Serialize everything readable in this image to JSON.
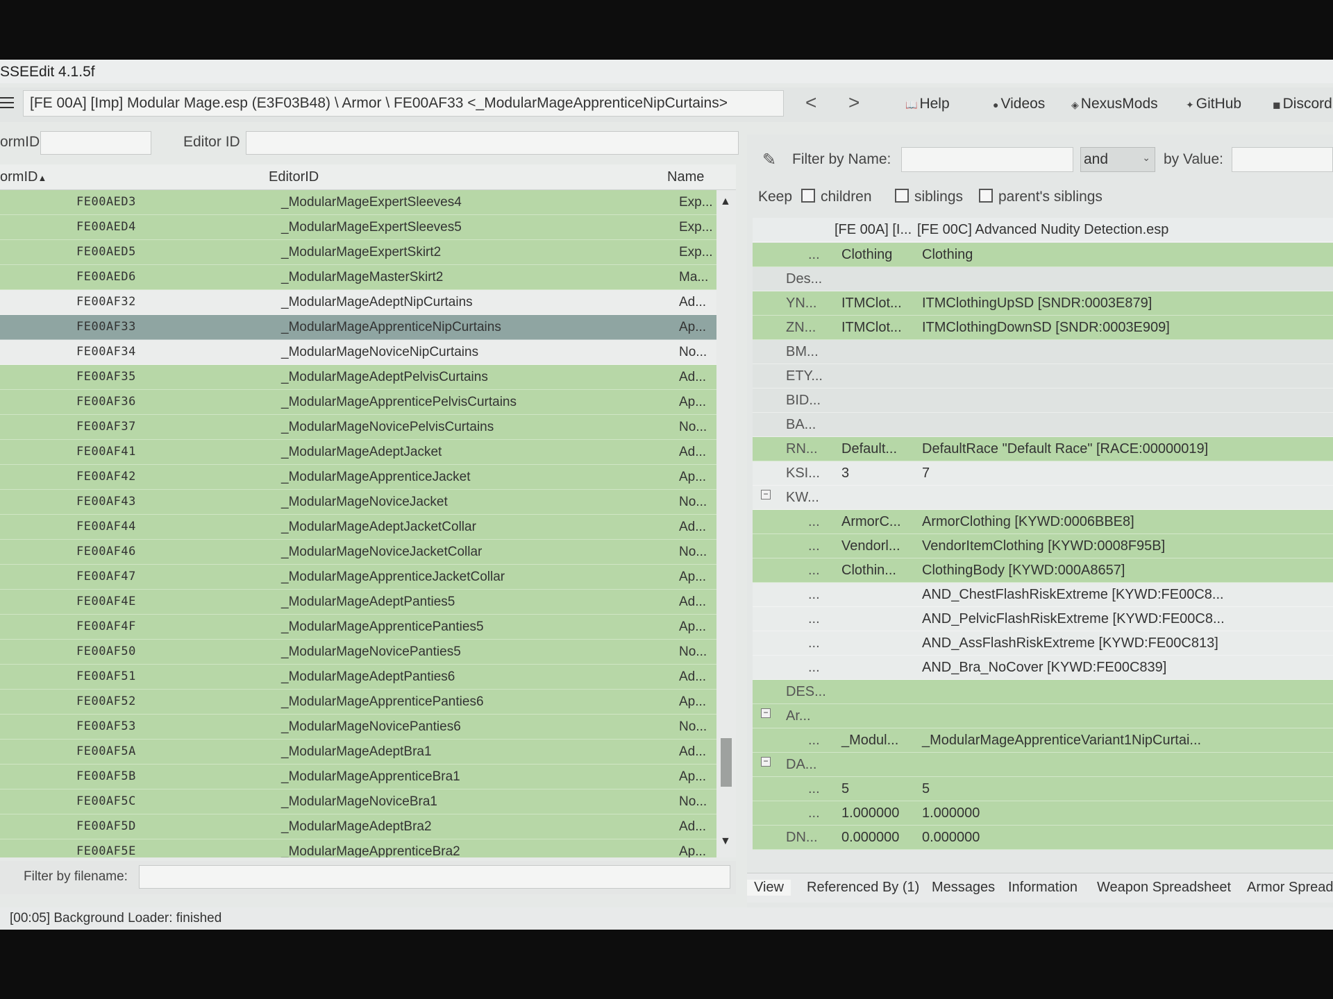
{
  "window": {
    "title": "SSEEdit 4.1.5f"
  },
  "nav": {
    "path": "[FE 00A] [Imp] Modular Mage.esp (E3F03B48) \\ Armor \\ FE00AF33 <_ModularMageApprenticeNipCurtains>",
    "back_glyph": "<",
    "forward_glyph": ">",
    "links": [
      "Help",
      "Videos",
      "NexusMods",
      "GitHub",
      "Discord"
    ]
  },
  "search": {
    "formid_label": "ormID",
    "formid_value": "",
    "editorid_label": "Editor ID",
    "editorid_value": ""
  },
  "record_list": {
    "columns": [
      "ormID",
      "EditorID",
      "Name"
    ],
    "sort_indicator": "▲",
    "rows": [
      {
        "formid": "FE00AED3",
        "editorid": "_ModularMageExpertSleeves4",
        "name": "Exp...",
        "color": "green"
      },
      {
        "formid": "FE00AED4",
        "editorid": "_ModularMageExpertSleeves5",
        "name": "Exp...",
        "color": "green"
      },
      {
        "formid": "FE00AED5",
        "editorid": "_ModularMageExpertSkirt2",
        "name": "Exp...",
        "color": "green"
      },
      {
        "formid": "FE00AED6",
        "editorid": "_ModularMageMasterSkirt2",
        "name": "Ma...",
        "color": "green"
      },
      {
        "formid": "FE00AF32",
        "editorid": "_ModularMageAdeptNipCurtains",
        "name": "Ad...",
        "color": "white"
      },
      {
        "formid": "FE00AF33",
        "editorid": "_ModularMageApprenticeNipCurtains",
        "name": "Ap...",
        "color": "selected"
      },
      {
        "formid": "FE00AF34",
        "editorid": "_ModularMageNoviceNipCurtains",
        "name": "No...",
        "color": "white"
      },
      {
        "formid": "FE00AF35",
        "editorid": "_ModularMageAdeptPelvisCurtains",
        "name": "Ad...",
        "color": "green"
      },
      {
        "formid": "FE00AF36",
        "editorid": "_ModularMageApprenticePelvisCurtains",
        "name": "Ap...",
        "color": "green"
      },
      {
        "formid": "FE00AF37",
        "editorid": "_ModularMageNovicePelvisCurtains",
        "name": "No...",
        "color": "green"
      },
      {
        "formid": "FE00AF41",
        "editorid": "_ModularMageAdeptJacket",
        "name": "Ad...",
        "color": "green"
      },
      {
        "formid": "FE00AF42",
        "editorid": "_ModularMageApprenticeJacket",
        "name": "Ap...",
        "color": "green"
      },
      {
        "formid": "FE00AF43",
        "editorid": "_ModularMageNoviceJacket",
        "name": "No...",
        "color": "green"
      },
      {
        "formid": "FE00AF44",
        "editorid": "_ModularMageAdeptJacketCollar",
        "name": "Ad...",
        "color": "green"
      },
      {
        "formid": "FE00AF46",
        "editorid": "_ModularMageNoviceJacketCollar",
        "name": "No...",
        "color": "green"
      },
      {
        "formid": "FE00AF47",
        "editorid": "_ModularMageApprenticeJacketCollar",
        "name": "Ap...",
        "color": "green"
      },
      {
        "formid": "FE00AF4E",
        "editorid": "_ModularMageAdeptPanties5",
        "name": "Ad...",
        "color": "green"
      },
      {
        "formid": "FE00AF4F",
        "editorid": "_ModularMageApprenticePanties5",
        "name": "Ap...",
        "color": "green"
      },
      {
        "formid": "FE00AF50",
        "editorid": "_ModularMageNovicePanties5",
        "name": "No...",
        "color": "green"
      },
      {
        "formid": "FE00AF51",
        "editorid": "_ModularMageAdeptPanties6",
        "name": "Ad...",
        "color": "green"
      },
      {
        "formid": "FE00AF52",
        "editorid": "_ModularMageApprenticePanties6",
        "name": "Ap...",
        "color": "green"
      },
      {
        "formid": "FE00AF53",
        "editorid": "_ModularMageNovicePanties6",
        "name": "No...",
        "color": "green"
      },
      {
        "formid": "FE00AF5A",
        "editorid": "_ModularMageAdeptBra1",
        "name": "Ad...",
        "color": "green"
      },
      {
        "formid": "FE00AF5B",
        "editorid": "_ModularMageApprenticeBra1",
        "name": "Ap...",
        "color": "green"
      },
      {
        "formid": "FE00AF5C",
        "editorid": "_ModularMageNoviceBra1",
        "name": "No...",
        "color": "green"
      },
      {
        "formid": "FE00AF5D",
        "editorid": "_ModularMageAdeptBra2",
        "name": "Ad...",
        "color": "green"
      },
      {
        "formid": "FE00AF5E",
        "editorid": "_ModularMageApprenticeBra2",
        "name": "Ap...",
        "color": "green"
      }
    ]
  },
  "filter_file": {
    "label": "Filter by filename:",
    "value": ""
  },
  "filter_panel": {
    "by_name_label": "Filter by Name:",
    "by_name_value": "",
    "operator": "and",
    "by_value_label": "by Value:",
    "by_value_value": "",
    "keep_label": "Keep",
    "keep_options": [
      "children",
      "siblings",
      "parent's siblings"
    ]
  },
  "record_view": {
    "header": {
      "key": "",
      "col_a": "[FE 00A] [I...",
      "col_b": "[FE 00C] Advanced Nudity Detection.esp"
    },
    "rows": [
      {
        "key": "...",
        "a": "Clothing",
        "b": "Clothing",
        "color": "g",
        "toggle": "",
        "indent": 1
      },
      {
        "key": "Des...",
        "a": "",
        "b": "",
        "color": "l",
        "toggle": "",
        "indent": 0
      },
      {
        "key": "YN...",
        "a": "ITMClot...",
        "b": "ITMClothingUpSD [SNDR:0003E879]",
        "color": "g",
        "toggle": "",
        "indent": 0
      },
      {
        "key": "ZN...",
        "a": "ITMClot...",
        "b": "ITMClothingDownSD [SNDR:0003E909]",
        "color": "g",
        "toggle": "",
        "indent": 0
      },
      {
        "key": "BM...",
        "a": "",
        "b": "",
        "color": "l",
        "toggle": "",
        "indent": 0
      },
      {
        "key": "ETY...",
        "a": "",
        "b": "",
        "color": "l",
        "toggle": "",
        "indent": 0
      },
      {
        "key": "BID...",
        "a": "",
        "b": "",
        "color": "l",
        "toggle": "",
        "indent": 0
      },
      {
        "key": "BA...",
        "a": "",
        "b": "",
        "color": "l",
        "toggle": "",
        "indent": 0
      },
      {
        "key": "RN...",
        "a": "Default...",
        "b": "DefaultRace \"Default Race\" [RACE:00000019]",
        "color": "g",
        "toggle": "",
        "indent": 0
      },
      {
        "key": "KSI...",
        "a": "3",
        "b": "7",
        "color": "w",
        "toggle": "",
        "indent": 0
      },
      {
        "key": "KW...",
        "a": "",
        "b": "",
        "color": "w",
        "toggle": "−",
        "indent": 0
      },
      {
        "key": "...",
        "a": "ArmorC...",
        "b": "ArmorClothing [KYWD:0006BBE8]",
        "color": "g",
        "toggle": "",
        "indent": 1
      },
      {
        "key": "...",
        "a": "Vendorl...",
        "b": "VendorItemClothing [KYWD:0008F95B]",
        "color": "g",
        "toggle": "",
        "indent": 1
      },
      {
        "key": "...",
        "a": "Clothin...",
        "b": "ClothingBody [KYWD:000A8657]",
        "color": "g",
        "toggle": "",
        "indent": 1
      },
      {
        "key": "...",
        "a": "",
        "b": "AND_ChestFlashRiskExtreme [KYWD:FE00C8...",
        "color": "w",
        "toggle": "",
        "indent": 1
      },
      {
        "key": "...",
        "a": "",
        "b": "AND_PelvicFlashRiskExtreme [KYWD:FE00C8...",
        "color": "w",
        "toggle": "",
        "indent": 1
      },
      {
        "key": "...",
        "a": "",
        "b": "AND_AssFlashRiskExtreme [KYWD:FE00C813]",
        "color": "w",
        "toggle": "",
        "indent": 1
      },
      {
        "key": "...",
        "a": "",
        "b": "AND_Bra_NoCover [KYWD:FE00C839]",
        "color": "w",
        "toggle": "",
        "indent": 1
      },
      {
        "key": "DES...",
        "a": "",
        "b": "",
        "color": "g",
        "toggle": "",
        "indent": 0
      },
      {
        "key": "Ar...",
        "a": "",
        "b": "",
        "color": "g",
        "toggle": "−",
        "indent": 0
      },
      {
        "key": "...",
        "a": "_Modul...",
        "b": "_ModularMageApprenticeVariant1NipCurtai...",
        "color": "g",
        "toggle": "",
        "indent": 1
      },
      {
        "key": "DA...",
        "a": "",
        "b": "",
        "color": "g",
        "toggle": "−",
        "indent": 0
      },
      {
        "key": "...",
        "a": "5",
        "b": "5",
        "color": "g",
        "toggle": "",
        "indent": 1
      },
      {
        "key": "...",
        "a": "1.000000",
        "b": "1.000000",
        "color": "g",
        "toggle": "",
        "indent": 1
      },
      {
        "key": "DN...",
        "a": "0.000000",
        "b": "0.000000",
        "color": "g",
        "toggle": "",
        "indent": 0
      }
    ]
  },
  "tabs": [
    "View",
    "Referenced By (1)",
    "Messages",
    "Information",
    "Weapon Spreadsheet",
    "Armor Spreadsheet"
  ],
  "status": {
    "text": "[00:05] Background Loader: finished"
  },
  "colors": {
    "conflict_green": "#b7d7a7",
    "selected_row": "#8fa5a2",
    "neutral_row": "#ebedec"
  }
}
